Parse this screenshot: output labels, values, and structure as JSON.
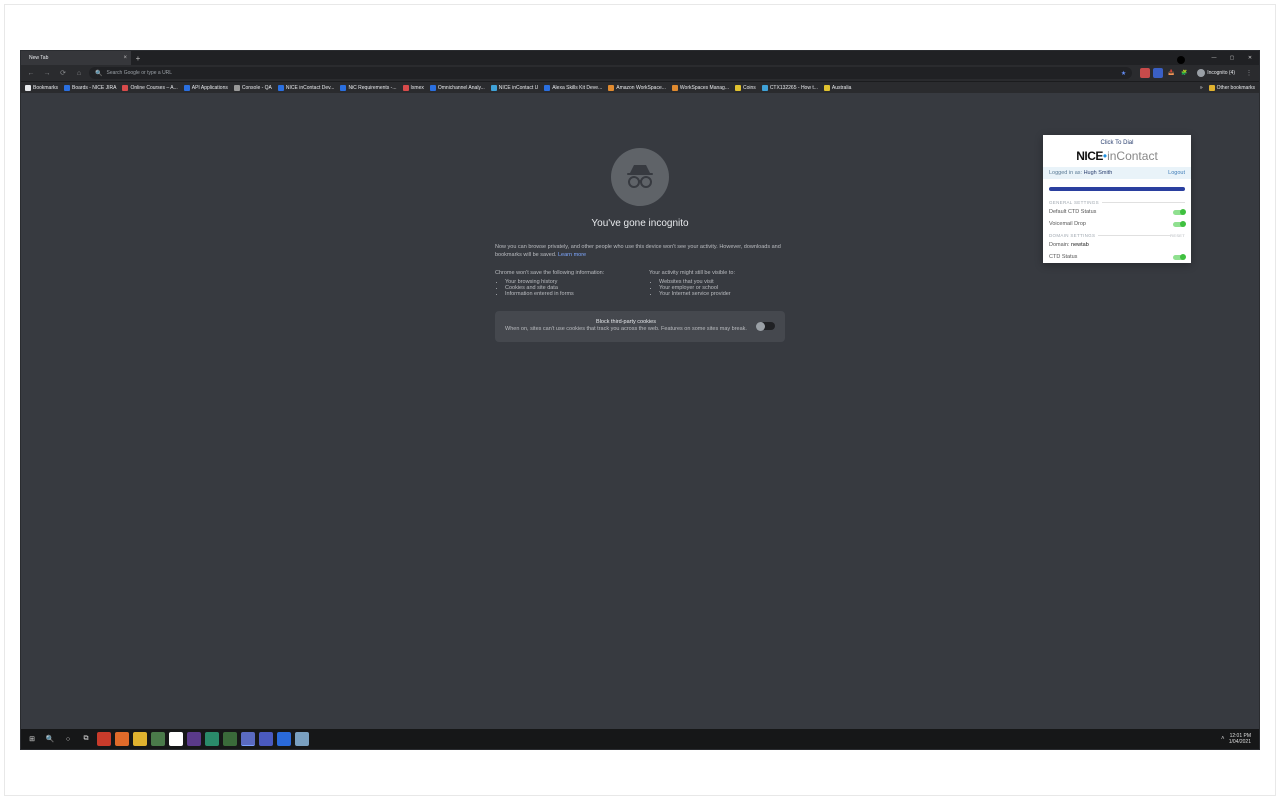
{
  "tab": {
    "title": "New Tab"
  },
  "omnibox": {
    "placeholder": "Search Google or type a URL"
  },
  "incognito_badge": "Incognito (4)",
  "bookmarks": [
    {
      "label": "Bookmarks",
      "color": "#e8eaed"
    },
    {
      "label": "Boards - NICE JIRA",
      "color": "#2a6fe0"
    },
    {
      "label": "Online Courses – A...",
      "color": "#d84b4b"
    },
    {
      "label": "API Applications",
      "color": "#2a6fe0"
    },
    {
      "label": "Console - QA",
      "color": "#999"
    },
    {
      "label": "NICE inContact Dev...",
      "color": "#2a6fe0"
    },
    {
      "label": "NiC Requirements -...",
      "color": "#2a6fe0"
    },
    {
      "label": "Ixmex",
      "color": "#d84b4b"
    },
    {
      "label": "Omnichannel Analy...",
      "color": "#2a6fe0"
    },
    {
      "label": "NICE inContact U",
      "color": "#3fa2d8"
    },
    {
      "label": "Alexa Skills Kit Deve...",
      "color": "#2a6fe0"
    },
    {
      "label": "Amazon WorkSpace...",
      "color": "#e08a2f"
    },
    {
      "label": "WorkSpaces Manag...",
      "color": "#e08a2f"
    },
    {
      "label": "Coins",
      "color": "#e0c22f"
    },
    {
      "label": "CTX132265 - How t...",
      "color": "#3fa2d8"
    },
    {
      "label": "Australia",
      "color": "#e0c22f"
    }
  ],
  "other_bookmarks": "Other bookmarks",
  "incognito": {
    "heading": "You've gone incognito",
    "para": "Now you can browse privately, and other people who use this device won't see your activity. However, downloads and bookmarks will be saved.",
    "learn_more": "Learn more",
    "wont_save_h": "Chrome won't save the following information:",
    "wont_save": [
      "Your browsing history",
      "Cookies and site data",
      "Information entered in forms"
    ],
    "might_visible_h": "Your activity might still be visible to:",
    "might_visible": [
      "Websites that you visit",
      "Your employer or school",
      "Your Internet service provider"
    ],
    "cookies_title": "Block third-party cookies",
    "cookies_text": "When on, sites can't use cookies that track you across the web. Features on some sites may break."
  },
  "ext": {
    "title": "Click To Dial",
    "brand_nice": "NICE",
    "brand_incontact": "inContact",
    "logged_in_as": "Logged in as:",
    "user": "Hugh Smith",
    "logout": "Logout",
    "sec1": "GENERAL SETTINGS",
    "row1": "Default CTD Status",
    "row2": "Voicemail Drop",
    "sec2": "DOMAIN SETTINGS",
    "reset": "RESET",
    "domain_label": "Domain:",
    "domain_value": "newtab",
    "row3": "CTD Status"
  },
  "clock": {
    "time": "12:01 PM",
    "date": "1/04/2021"
  }
}
